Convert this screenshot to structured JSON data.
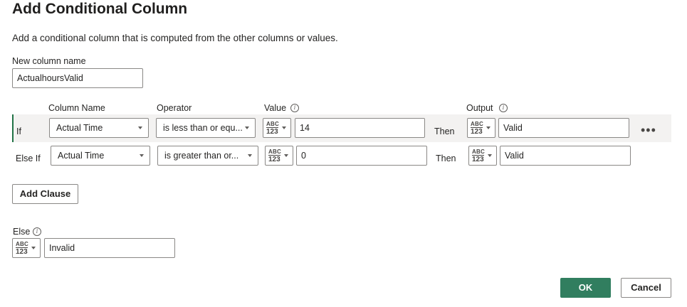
{
  "dialog": {
    "title": "Add Conditional Column",
    "subtitle": "Add a conditional column that is computed from the other columns or values."
  },
  "new_column": {
    "label": "New column name",
    "value": "ActualhoursValid"
  },
  "headers": {
    "column_name": "Column Name",
    "operator": "Operator",
    "value": "Value",
    "output": "Output"
  },
  "type_icon": {
    "abc": "ABC",
    "num": "123"
  },
  "rows": [
    {
      "keyword": "If",
      "column": "Actual Time",
      "operator": "is less than or equ...",
      "value": "14",
      "then": "Then",
      "output": "Valid"
    },
    {
      "keyword": "Else If",
      "column": "Actual Time",
      "operator": "is greater than or...",
      "value": "0",
      "then": "Then",
      "output": "Valid"
    }
  ],
  "add_clause": "Add Clause",
  "else": {
    "label": "Else",
    "value": "Invalid"
  },
  "buttons": {
    "ok": "OK",
    "cancel": "Cancel"
  },
  "icons": {
    "info": "i",
    "more": "•••"
  },
  "colors": {
    "accent": "#217346",
    "primary_button": "#317e5f",
    "row_highlight": "#f3f2f1"
  }
}
